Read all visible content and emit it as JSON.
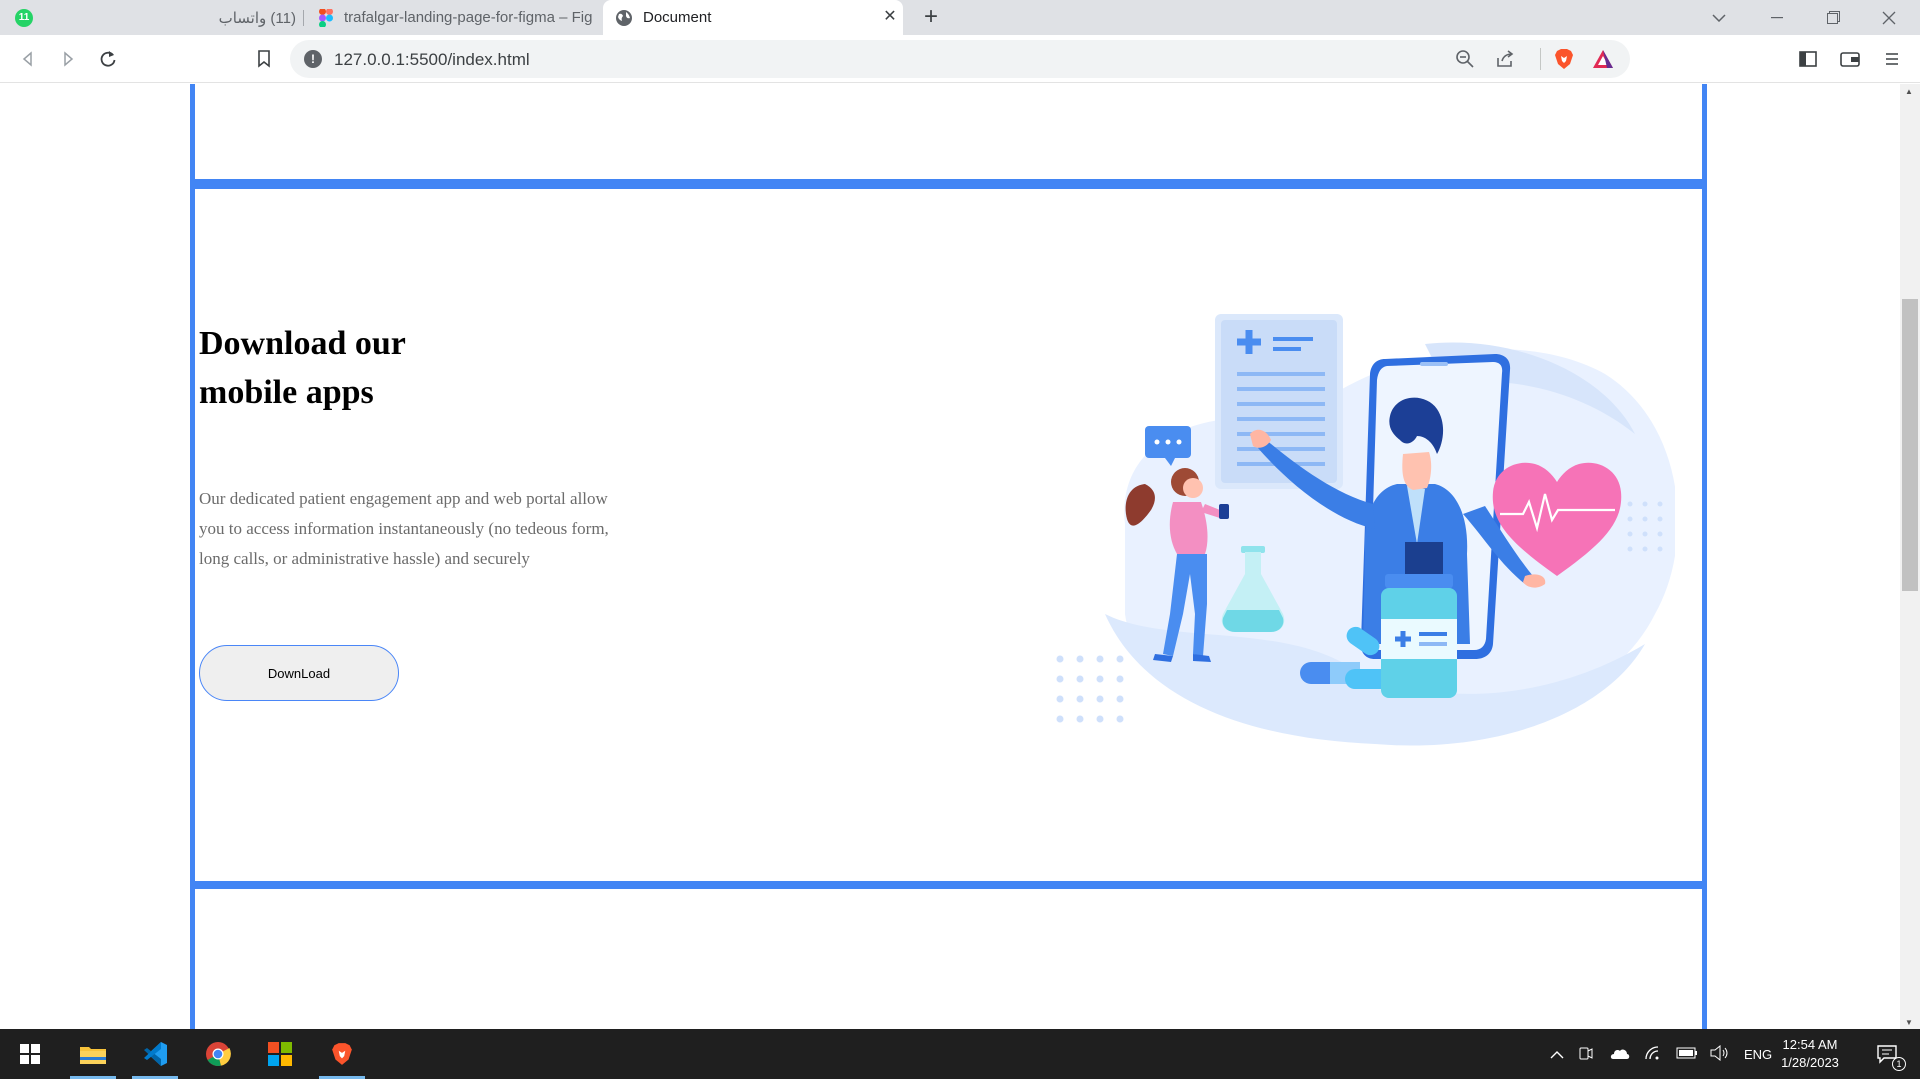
{
  "browser": {
    "tabs": [
      {
        "label": "(11) واتساب",
        "badge": "11"
      },
      {
        "label": "trafalgar-landing-page-for-figma – Fig"
      },
      {
        "label": "Document"
      }
    ],
    "url": "127.0.0.1:5500/index.html",
    "new_tab_symbol": "+",
    "close_symbol": "✕"
  },
  "page": {
    "download_section": {
      "heading_line1": "Download our",
      "heading_line2": "mobile apps",
      "description": "Our dedicated patient engagement app and web portal allow you to access information instantaneously (no tedeous form, long calls, or administrative hassle) and securely",
      "button_label": "DownLoad",
      "accent_color": "#4285f4"
    }
  },
  "taskbar": {
    "apps": [
      "windows-start-icon",
      "file-explorer-icon",
      "vscode-icon",
      "chrome-icon",
      "microsoft-store-icon",
      "brave-icon"
    ],
    "language": "ENG",
    "time": "12:54 AM",
    "date": "1/28/2023",
    "notification_count": "1"
  }
}
